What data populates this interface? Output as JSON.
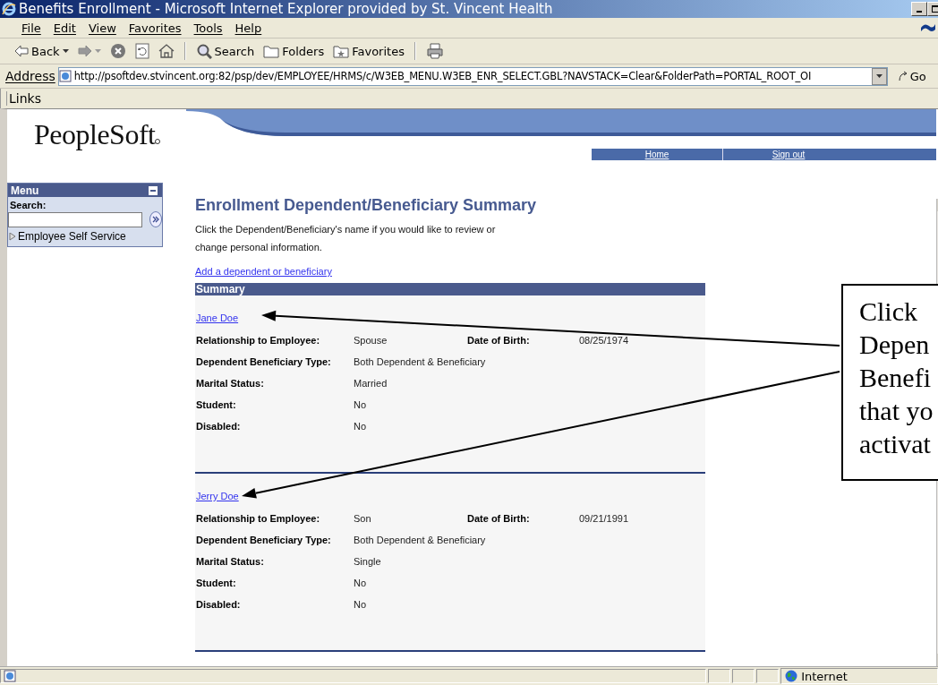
{
  "window": {
    "title": "Benefits Enrollment - Microsoft Internet Explorer provided by St. Vincent Health"
  },
  "menu_bar": [
    "File",
    "Edit",
    "View",
    "Favorites",
    "Tools",
    "Help"
  ],
  "toolbar": [
    {
      "kind": "back",
      "label": "Back"
    },
    {
      "kind": "forward"
    },
    {
      "kind": "stop"
    },
    {
      "kind": "refresh"
    },
    {
      "kind": "home"
    },
    {
      "kind": "search",
      "label": "Search"
    },
    {
      "kind": "folders",
      "label": "Folders"
    },
    {
      "kind": "favorites",
      "label": "Favorites"
    },
    {
      "kind": "print"
    }
  ],
  "address_bar": {
    "label": "Address",
    "url": "http://psoftdev.stvincent.org:82/psp/dev/EMPLOYEE/HRMS/c/W3EB_MENU.W3EB_ENR_SELECT.GBL?NAVSTACK=Clear&FolderPath=PORTAL_ROOT_OI",
    "go": "Go"
  },
  "links_bar": {
    "label": "Links"
  },
  "page": {
    "logo": "PeopleSoft",
    "nav": [
      "Home",
      "Sign out"
    ],
    "menu": {
      "title": "Menu",
      "search_label": "Search:",
      "items": [
        {
          "label": "Employee Self Service",
          "expanded": false
        }
      ]
    },
    "heading": "Enrollment Dependent/Beneficiary Summary",
    "instructions": "Click the Dependent/Beneficiary's name if you would like to review or change personal information.",
    "add_link": "Add a dependent or beneficiary",
    "summary_title": "Summary",
    "dependents": [
      {
        "name": "Jane Doe",
        "dob": {
          "label": "Date of Birth:",
          "value": "08/25/1974"
        },
        "fields": [
          {
            "label": "Relationship to Employee:",
            "value": "Spouse"
          },
          {
            "label": "Dependent Beneficiary Type:",
            "value": "Both Dependent & Beneficiary"
          },
          {
            "label": "Marital Status:",
            "value": "Married"
          },
          {
            "label": "Student:",
            "value": "No"
          },
          {
            "label": "Disabled:",
            "value": "No"
          }
        ]
      },
      {
        "name": "Jerry Doe",
        "dob": {
          "label": "Date of Birth:",
          "value": "09/21/1991"
        },
        "fields": [
          {
            "label": "Relationship to Employee:",
            "value": "Son"
          },
          {
            "label": "Dependent Beneficiary Type:",
            "value": "Both Dependent & Beneficiary"
          },
          {
            "label": "Marital Status:",
            "value": "Single"
          },
          {
            "label": "Student:",
            "value": "No"
          },
          {
            "label": "Disabled:",
            "value": "No"
          }
        ]
      }
    ]
  },
  "callout": {
    "lines": [
      "Click",
      "Depen",
      "Benefi",
      "that yo",
      "activat"
    ]
  },
  "status_bar": {
    "zone": "Internet"
  }
}
